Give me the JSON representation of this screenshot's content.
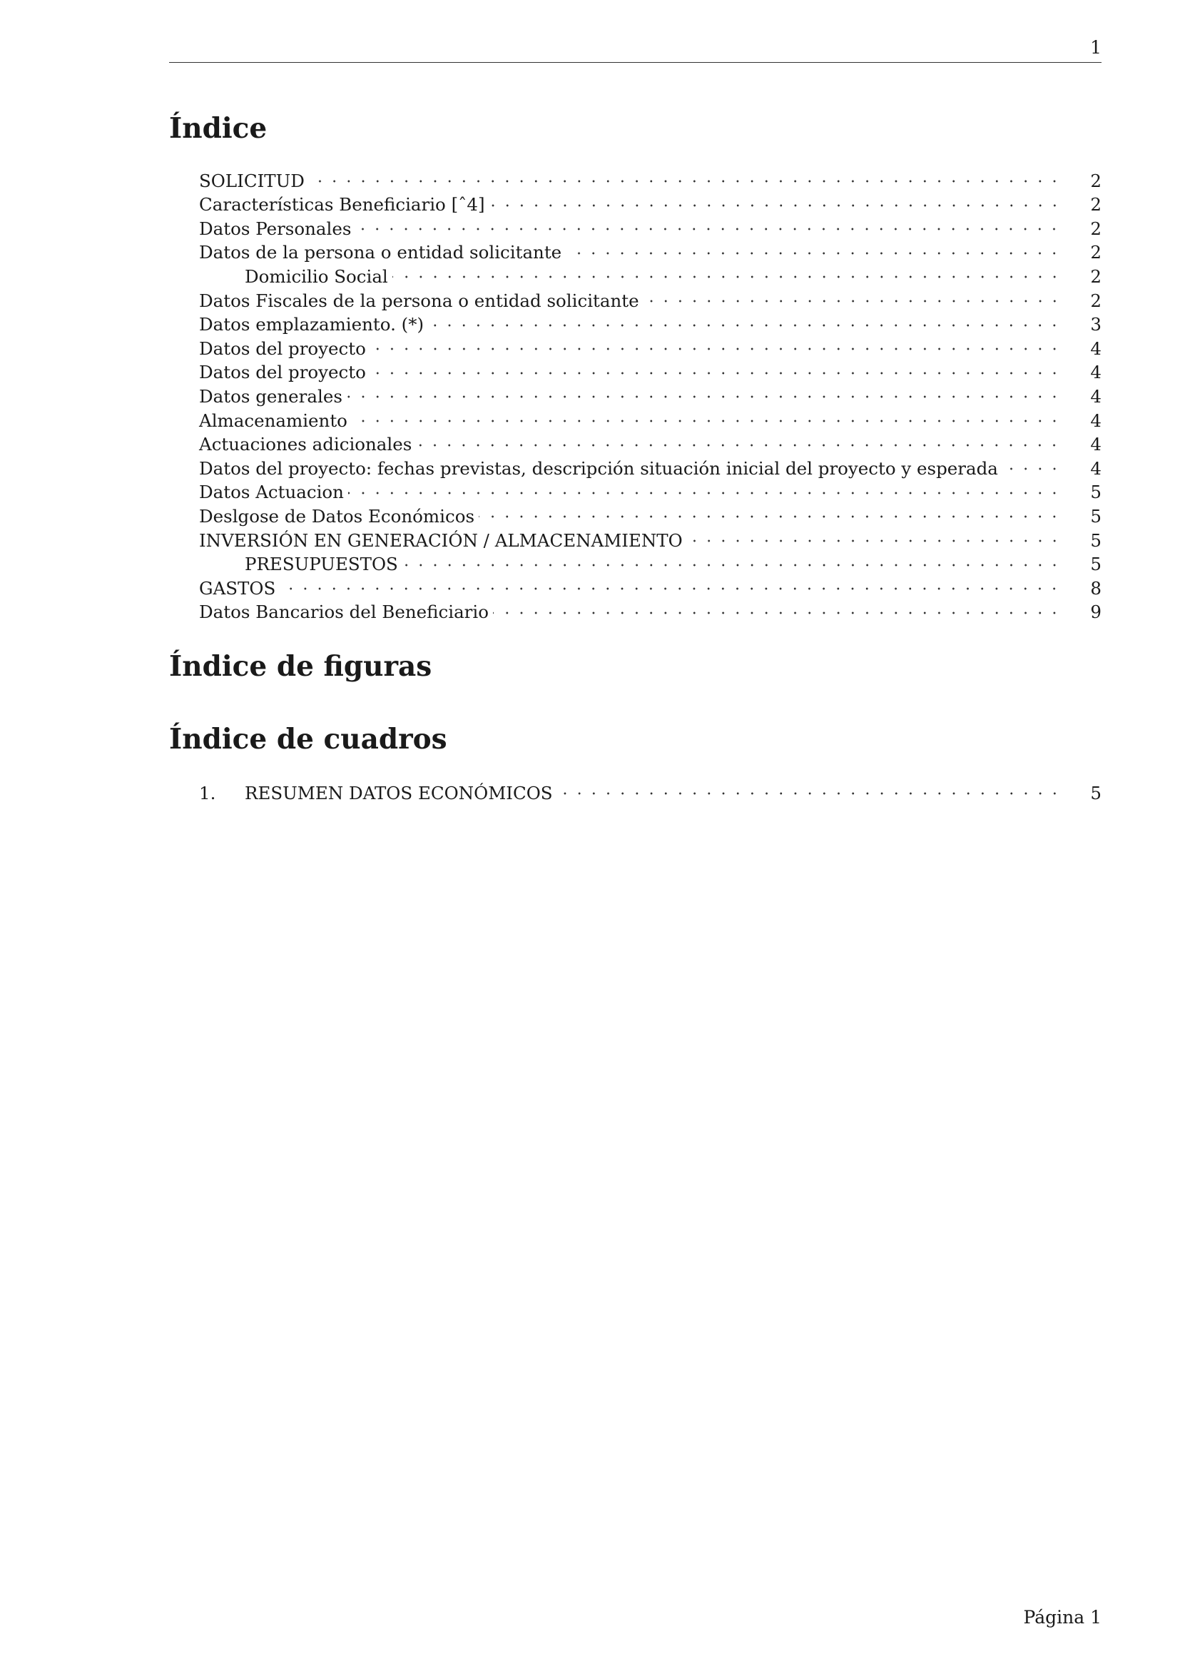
{
  "header": {
    "page_number": "1"
  },
  "contents": {
    "title": "Índice",
    "entries": [
      {
        "title": "SOLICITUD",
        "page": "2",
        "level": 1
      },
      {
        "title": "Características Beneficiario [ˆ4]",
        "page": "2",
        "level": 1
      },
      {
        "title": "Datos Personales",
        "page": "2",
        "level": 1
      },
      {
        "title": "Datos de la persona o entidad solicitante",
        "page": "2",
        "level": 1
      },
      {
        "title": "Domicilio Social",
        "page": "2",
        "level": 2
      },
      {
        "title": "Datos Fiscales de la persona o entidad solicitante",
        "page": "2",
        "level": 1
      },
      {
        "title": "Datos emplazamiento. (*)",
        "page": "3",
        "level": 1
      },
      {
        "title": "Datos del proyecto",
        "page": "4",
        "level": 1
      },
      {
        "title": "Datos del proyecto",
        "page": "4",
        "level": 1
      },
      {
        "title": "Datos generales",
        "page": "4",
        "level": 1
      },
      {
        "title": "Almacenamiento",
        "page": "4",
        "level": 1
      },
      {
        "title": "Actuaciones adicionales",
        "page": "4",
        "level": 1
      },
      {
        "title": "Datos del proyecto: fechas previstas, descripción situación inicial del proyecto y esperada",
        "page": "4",
        "level": 1
      },
      {
        "title": "Datos Actuacion",
        "page": "5",
        "level": 1
      },
      {
        "title": "Deslgose de Datos Económicos",
        "page": "5",
        "level": 1
      },
      {
        "title": "INVERSIÓN EN GENERACIÓN / ALMACENAMIENTO",
        "page": "5",
        "level": 1
      },
      {
        "title": "PRESUPUESTOS",
        "page": "5",
        "level": 2
      },
      {
        "title": "GASTOS",
        "page": "8",
        "level": 1
      },
      {
        "title": "Datos Bancarios del Beneficiario",
        "page": "9",
        "level": 1
      }
    ]
  },
  "figures": {
    "title": "Índice de figuras"
  },
  "tables": {
    "title": "Índice de cuadros",
    "entries": [
      {
        "number": "1.",
        "title": "RESUMEN DATOS ECONÓMICOS",
        "page": "5"
      }
    ]
  },
  "footer": {
    "text": "Página 1"
  }
}
